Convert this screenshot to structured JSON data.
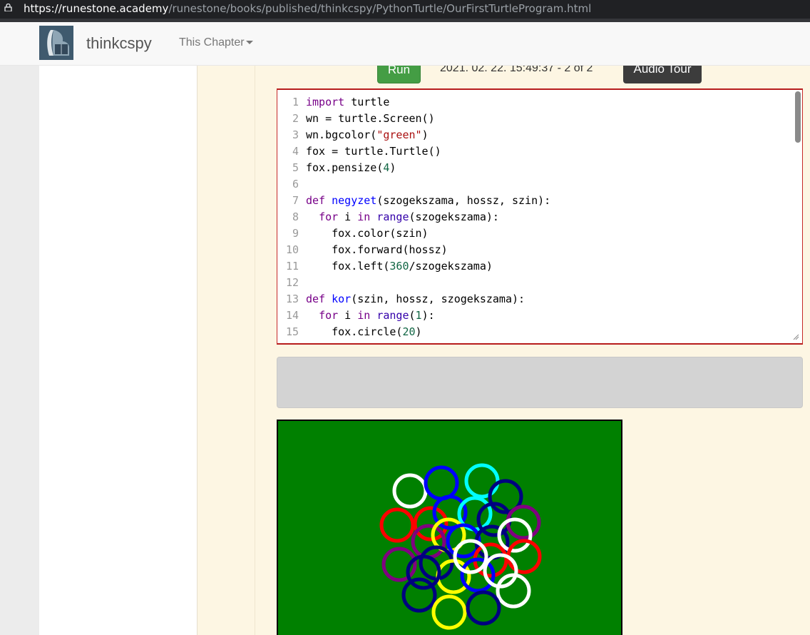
{
  "browser": {
    "url_host": "https://runestone.academy",
    "url_path": "/runestone/books/published/thinkcspy/PythonTurtle/OurFirstTurtleProgram.html"
  },
  "navbar": {
    "brand": "thinkcspy",
    "chapter_menu": "This Chapter"
  },
  "activity": {
    "run_label": "Run",
    "timestamp": "2021. 02. 22. 15:49:37 - 2 of 2",
    "audio_label": "Audio Tour"
  },
  "editor": {
    "line_numbers": [
      "1",
      "2",
      "3",
      "4",
      "5",
      "6",
      "7",
      "8",
      "9",
      "10",
      "11",
      "12",
      "13",
      "14",
      "15"
    ],
    "lines": [
      [
        [
          "import",
          "kw"
        ],
        [
          " turtle",
          ""
        ]
      ],
      [
        [
          "wn = turtle.Screen()",
          ""
        ]
      ],
      [
        [
          "wn.bgcolor(",
          ""
        ],
        [
          "\"green\"",
          "str"
        ],
        [
          ")",
          ""
        ]
      ],
      [
        [
          "fox = turtle.Turtle()",
          ""
        ]
      ],
      [
        [
          "fox.pensize(",
          ""
        ],
        [
          "4",
          "num"
        ],
        [
          ")",
          ""
        ]
      ],
      [
        [
          "",
          ""
        ]
      ],
      [
        [
          "def",
          "kw"
        ],
        [
          " ",
          ""
        ],
        [
          "negyzet",
          "def"
        ],
        [
          "(szogekszama, hossz, szin):",
          ""
        ]
      ],
      [
        [
          "  ",
          ""
        ],
        [
          "for",
          "kw"
        ],
        [
          " i ",
          ""
        ],
        [
          "in",
          "kw"
        ],
        [
          " ",
          ""
        ],
        [
          "range",
          "bi"
        ],
        [
          "(szogekszama):",
          ""
        ]
      ],
      [
        [
          "    fox.color(szin)",
          ""
        ]
      ],
      [
        [
          "    fox.forward(hossz)",
          ""
        ]
      ],
      [
        [
          "    fox.left(",
          ""
        ],
        [
          "360",
          "num"
        ],
        [
          "/szogekszama)",
          ""
        ]
      ],
      [
        [
          "",
          ""
        ]
      ],
      [
        [
          "def",
          "kw"
        ],
        [
          " ",
          ""
        ],
        [
          "kor",
          "def"
        ],
        [
          "(szin, hossz, szogekszama):",
          ""
        ]
      ],
      [
        [
          "  ",
          ""
        ],
        [
          "for",
          "kw"
        ],
        [
          " i ",
          ""
        ],
        [
          "in",
          "kw"
        ],
        [
          " ",
          ""
        ],
        [
          "range",
          "bi"
        ],
        [
          "(",
          ""
        ],
        [
          "1",
          "num"
        ],
        [
          "):",
          ""
        ]
      ],
      [
        [
          "    fox.circle(",
          ""
        ],
        [
          "20",
          "num"
        ],
        [
          ")",
          ""
        ]
      ]
    ]
  },
  "turtle_canvas": {
    "background": "#008000",
    "pen_colors": [
      "white",
      "blue",
      "cyan",
      "navy",
      "red",
      "yellow",
      "purple"
    ]
  }
}
